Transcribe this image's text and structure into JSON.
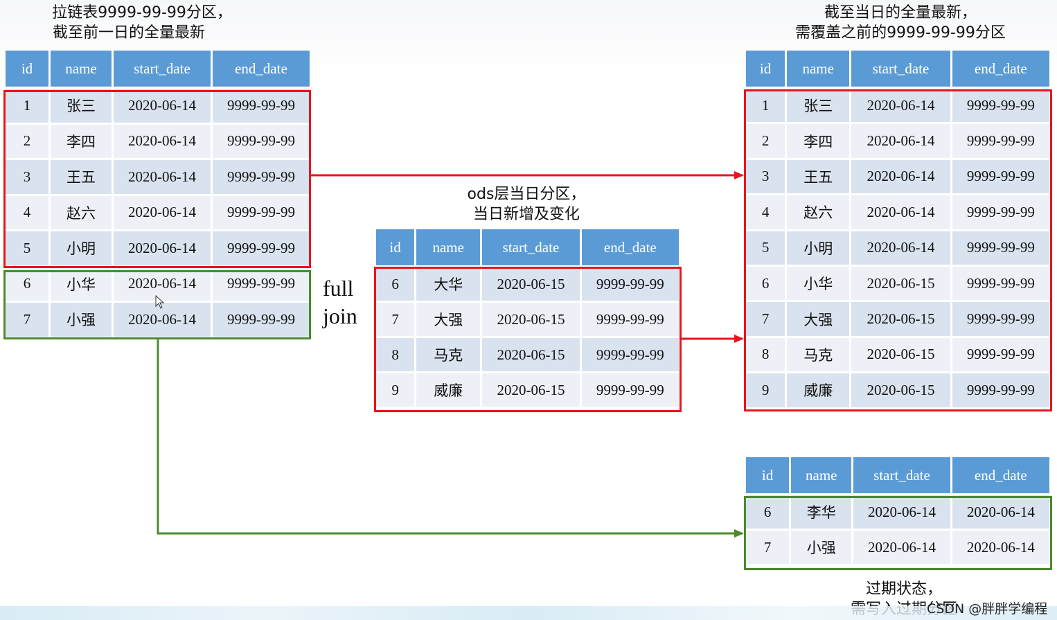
{
  "captions": {
    "left_line1": "拉链表9999-99-99分区，",
    "left_line2": "截至前一日的全量最新",
    "right_line1": "截至当日的全量最新，",
    "right_line2": "需覆盖之前的9999-99-99分区",
    "mid_line1": "ods层当日分区，",
    "mid_line2": "当日新增及变化",
    "bottom_line1": "过期状态，",
    "bottom_line2": "需写入过期分区"
  },
  "join_label": {
    "line1": "full",
    "line2": "join"
  },
  "watermark": "CSDN @胖胖学编程",
  "headers": {
    "id": "id",
    "name": "name",
    "start": "start_date",
    "end": "end_date"
  },
  "left_table": [
    [
      "1",
      "张三",
      "2020-06-14",
      "9999-99-99"
    ],
    [
      "2",
      "李四",
      "2020-06-14",
      "9999-99-99"
    ],
    [
      "3",
      "王五",
      "2020-06-14",
      "9999-99-99"
    ],
    [
      "4",
      "赵六",
      "2020-06-14",
      "9999-99-99"
    ],
    [
      "5",
      "小明",
      "2020-06-14",
      "9999-99-99"
    ],
    [
      "6",
      "小华",
      "2020-06-14",
      "9999-99-99"
    ],
    [
      "7",
      "小强",
      "2020-06-14",
      "9999-99-99"
    ]
  ],
  "mid_table": [
    [
      "6",
      "大华",
      "2020-06-15",
      "9999-99-99"
    ],
    [
      "7",
      "大强",
      "2020-06-15",
      "9999-99-99"
    ],
    [
      "8",
      "马克",
      "2020-06-15",
      "9999-99-99"
    ],
    [
      "9",
      "威廉",
      "2020-06-15",
      "9999-99-99"
    ]
  ],
  "right_table": [
    [
      "1",
      "张三",
      "2020-06-14",
      "9999-99-99"
    ],
    [
      "2",
      "李四",
      "2020-06-14",
      "9999-99-99"
    ],
    [
      "3",
      "王五",
      "2020-06-14",
      "9999-99-99"
    ],
    [
      "4",
      "赵六",
      "2020-06-14",
      "9999-99-99"
    ],
    [
      "5",
      "小明",
      "2020-06-14",
      "9999-99-99"
    ],
    [
      "6",
      "小华",
      "2020-06-15",
      "9999-99-99"
    ],
    [
      "7",
      "大强",
      "2020-06-15",
      "9999-99-99"
    ],
    [
      "8",
      "马克",
      "2020-06-15",
      "9999-99-99"
    ],
    [
      "9",
      "威廉",
      "2020-06-15",
      "9999-99-99"
    ]
  ],
  "bottom_table": [
    [
      "6",
      "李华",
      "2020-06-14",
      "2020-06-14"
    ],
    [
      "7",
      "小强",
      "2020-06-14",
      "2020-06-14"
    ]
  ],
  "colors": {
    "header": "#5b9bd5",
    "red_box": "#e8141c",
    "green_box": "#4c8a2e"
  }
}
